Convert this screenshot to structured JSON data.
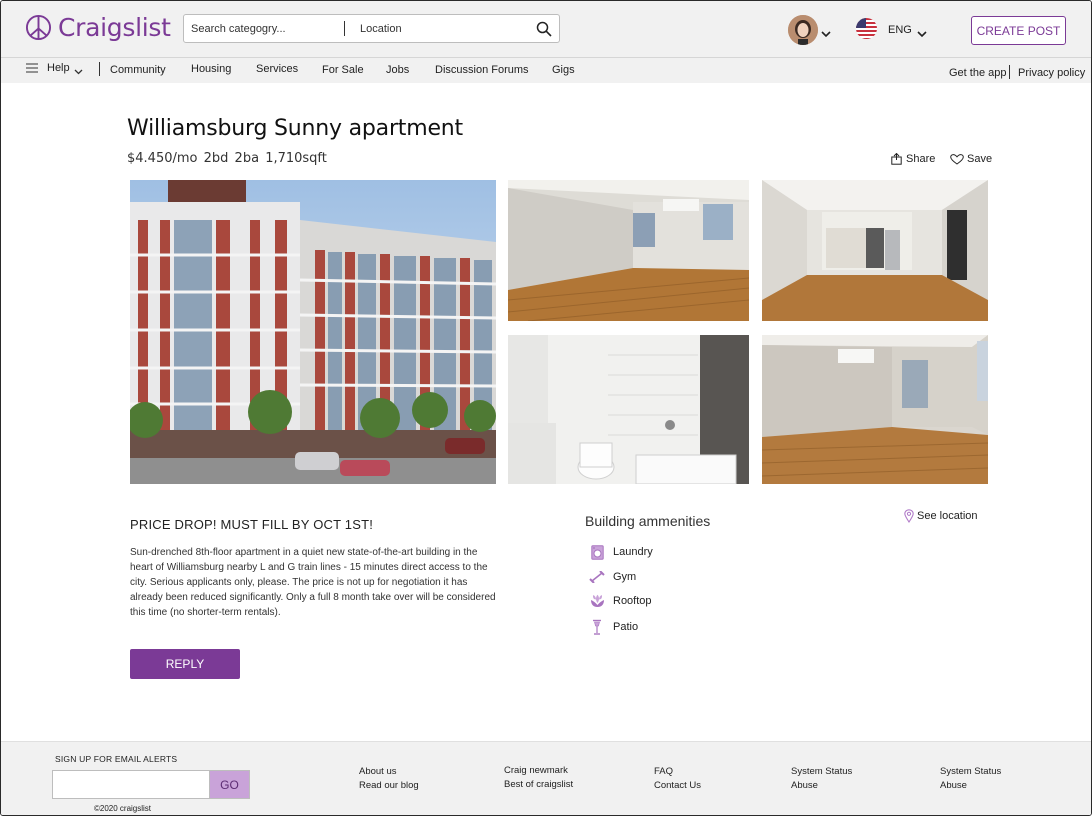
{
  "brand": {
    "name": "Craigslist",
    "color": "#7b3a96"
  },
  "header": {
    "search_placeholder": "Search categogry...",
    "location_placeholder": "Location",
    "language": "ENG",
    "create_post": "CREATE POST"
  },
  "nav": {
    "help": "Help",
    "items": [
      "Community",
      "Housing",
      "Services",
      "For Sale",
      "Jobs",
      "Discussion Forums",
      "Gigs"
    ],
    "get_app": "Get the app",
    "privacy": "Privacy policy"
  },
  "listing": {
    "title": "Williamsburg Sunny apartment",
    "price": "$4.450/mo",
    "beds": "2bd",
    "baths": "2ba",
    "sqft": "1,710sqft",
    "share": "Share",
    "save": "Save",
    "headline": "PRICE DROP! MUST FILL BY OCT 1ST!",
    "description": "Sun-drenched 8th-floor apartment in a quiet new state-of-the-art building in the heart of Williamsburg nearby  L and G train lines - 15 minutes direct access to the city. Serious applicants only, please. The price is not up for negotiation it has already been reduced significantly. Only a full 8 month take over will be considered this time (no shorter-term rentals).",
    "reply": "REPLY"
  },
  "amenities": {
    "title": "Building ammenities",
    "see_location": "See location",
    "items": [
      {
        "label": "Laundry",
        "icon": "laundry-icon"
      },
      {
        "label": "Gym",
        "icon": "dumbbell-icon"
      },
      {
        "label": "Rooftop",
        "icon": "flower-icon"
      },
      {
        "label": "Patio",
        "icon": "patio-lamp-icon"
      }
    ]
  },
  "footer": {
    "signup": "SIGN UP  FOR EMAIL ALERTS",
    "go": "GO",
    "copyright": "©2020 craigslist",
    "col1": [
      "About us",
      "Read our blog"
    ],
    "col2": [
      "Craig newmark",
      "Best of craigslist"
    ],
    "col3": [
      "FAQ",
      "Contact  Us"
    ],
    "col4": [
      "System Status",
      "Abuse"
    ],
    "col5": [
      "System Status",
      "Abuse"
    ]
  }
}
